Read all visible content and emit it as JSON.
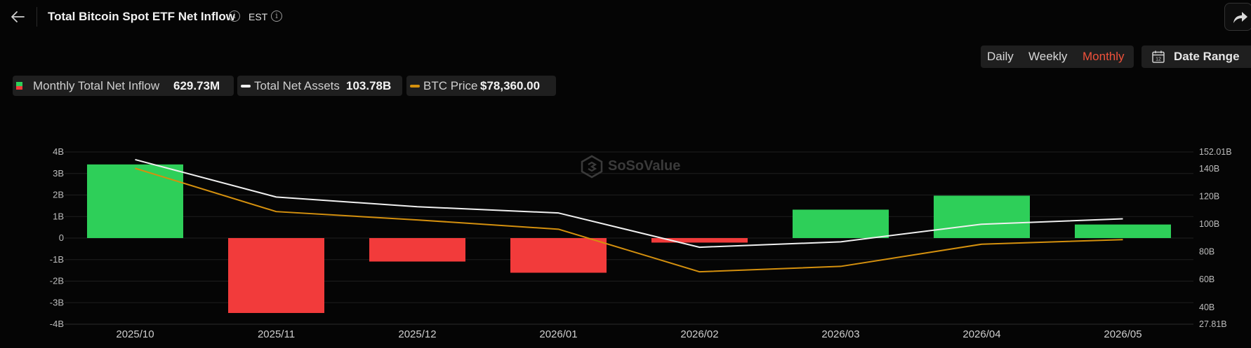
{
  "header": {
    "title": "Total Bitcoin Spot ETF Net Inflow",
    "timezone": "EST"
  },
  "controls": {
    "periods": [
      "Daily",
      "Weekly",
      "Monthly"
    ],
    "active_period": "Monthly",
    "date_range_label": "Date Range"
  },
  "legend": [
    {
      "name": "Monthly Total Net Inflow",
      "value": "629.73M"
    },
    {
      "name": "Total Net Assets",
      "value": "103.78B"
    },
    {
      "name": "BTC Price",
      "value": "$78,360.00"
    }
  ],
  "colors": {
    "positive_bar": "#2ecf59",
    "negative_bar": "#f23b3b",
    "net_assets_line": "#f0f0f0",
    "btc_price_line": "#d4900e",
    "active_period": "#f0513b"
  },
  "watermark": "SoSoValue",
  "chart_data": {
    "type": "bar",
    "categories": [
      "2025/10",
      "2025/11",
      "2025/12",
      "2026/01",
      "2026/02",
      "2026/03",
      "2026/04",
      "2026/05"
    ],
    "series": [
      {
        "name": "Monthly Total Net Inflow",
        "type": "bar",
        "axis": "left",
        "unit": "B",
        "values": [
          3.42,
          -3.48,
          -1.09,
          -1.61,
          -0.21,
          1.32,
          1.97,
          0.63
        ]
      },
      {
        "name": "Total Net Assets",
        "type": "line",
        "axis": "right",
        "unit": "B",
        "values": [
          146.5,
          119.5,
          112.5,
          108.0,
          83.3,
          87.2,
          99.9,
          103.78
        ]
      },
      {
        "name": "BTC Price",
        "type": "line",
        "axis": "right_scaled",
        "values": [
          140.2,
          109.0,
          103.0,
          96.3,
          65.6,
          69.5,
          85.5,
          88.8
        ]
      }
    ],
    "y_left": {
      "min": -4,
      "max": 4,
      "ticks": [
        "4B",
        "3B",
        "2B",
        "1B",
        "0",
        "-1B",
        "-2B",
        "-3B",
        "-4B"
      ]
    },
    "y_right": {
      "min": 27.81,
      "max": 152.01,
      "ticks": [
        "152.01B",
        "140B",
        "120B",
        "100B",
        "80B",
        "60B",
        "40B",
        "27.81B"
      ]
    },
    "grid": true
  }
}
